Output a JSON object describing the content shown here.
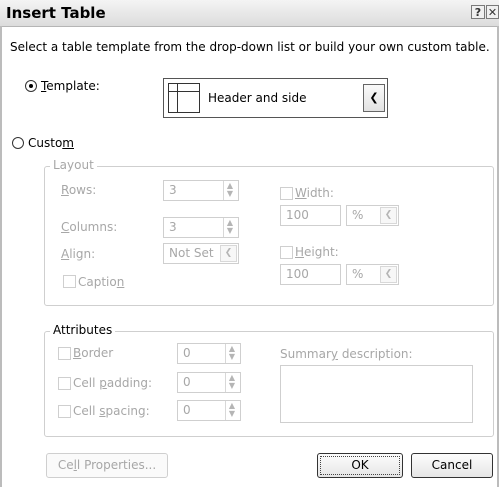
{
  "window": {
    "title": "Insert Table",
    "help_button": "?",
    "close_button": "✕"
  },
  "intro_text": "Select a table template from the drop-down list or build your own custom table.",
  "template_option": {
    "label_first": "T",
    "label_rest": "emplate:",
    "selected": true,
    "dropdown_value": "Header and side"
  },
  "custom_option": {
    "label_first": "Custo",
    "label_u": "m",
    "selected": false
  },
  "layout": {
    "legend": "Layout",
    "rows_label_u": "R",
    "rows_label_rest": "ows:",
    "rows_value": "3",
    "columns_label_u": "C",
    "columns_label_rest": "olumns:",
    "columns_value": "3",
    "align_label_u": "A",
    "align_label_rest": "lign:",
    "align_value": "Not Set",
    "caption_label_a": "Captio",
    "caption_label_u": "n",
    "width_label_u": "W",
    "width_label_rest": "idth:",
    "width_value": "100",
    "width_unit": "%",
    "height_label_u": "H",
    "height_label_rest": "eight:",
    "height_value": "100",
    "height_unit": "%"
  },
  "attributes": {
    "legend": "Attributes",
    "border_label_u": "B",
    "border_label_rest": "order",
    "border_value": "0",
    "cell_padding_label_a": "Cell ",
    "cell_padding_label_u": "p",
    "cell_padding_label_rest": "adding:",
    "cell_padding_value": "0",
    "cell_spacing_label_a": "Cell ",
    "cell_spacing_label_u": "s",
    "cell_spacing_label_rest": "pacing:",
    "cell_spacing_value": "0",
    "summary_label_a": "Summar",
    "summary_label_u": "y",
    "summary_label_rest": " description:",
    "summary_value": ""
  },
  "buttons": {
    "cell_properties_a": "Ce",
    "cell_properties_u": "l",
    "cell_properties_rest": "l Properties...",
    "ok": "OK",
    "cancel": "Cancel"
  },
  "icons": {
    "spin": "spin-up-down-icon",
    "dropdown": "chevron-down-icon"
  }
}
